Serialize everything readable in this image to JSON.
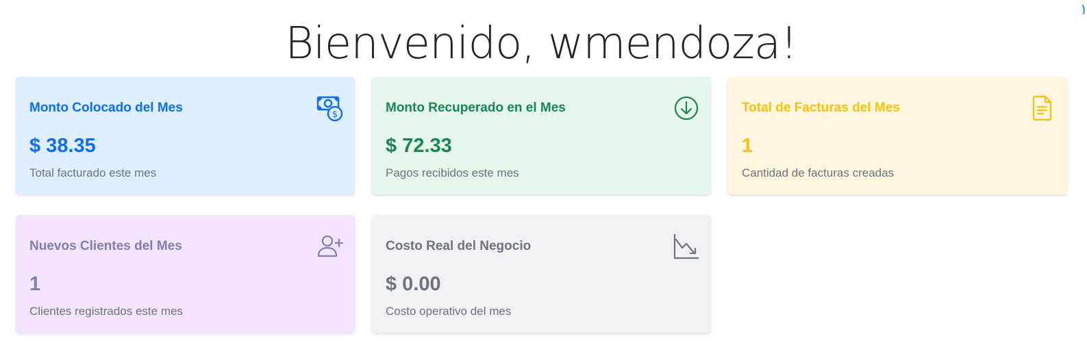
{
  "welcome": {
    "title": "Bienvenido, wmendoza!"
  },
  "cards": [
    {
      "title": "Monto Colocado del Mes",
      "value": "$ 38.35",
      "description": "Total facturado este mes",
      "icon": "cash-coin-icon",
      "accent": "#0d6efd",
      "background": "#e0efff"
    },
    {
      "title": "Monto Recuperado en el Mes",
      "value": "$ 72.33",
      "description": "Pagos recibidos este mes",
      "icon": "arrow-down-circle-icon",
      "accent": "#198754",
      "background": "#e6f7ec"
    },
    {
      "title": "Total de Facturas del Mes",
      "value": "1",
      "description": "Cantidad de facturas creadas",
      "icon": "file-text-icon",
      "accent": "#ffc107",
      "background": "#fff7e0"
    },
    {
      "title": "Nuevos Clientes del Mes",
      "value": "1",
      "description": "Clientes registrados este mes",
      "icon": "person-plus-icon",
      "accent": "#7d7fb5",
      "background": "#f3e5fd"
    },
    {
      "title": "Costo Real del Negocio",
      "value": "$ 0.00",
      "description": "Costo operativo del mes",
      "icon": "graph-down-icon",
      "accent": "#6c757d",
      "background": "#f1f2f6"
    }
  ]
}
